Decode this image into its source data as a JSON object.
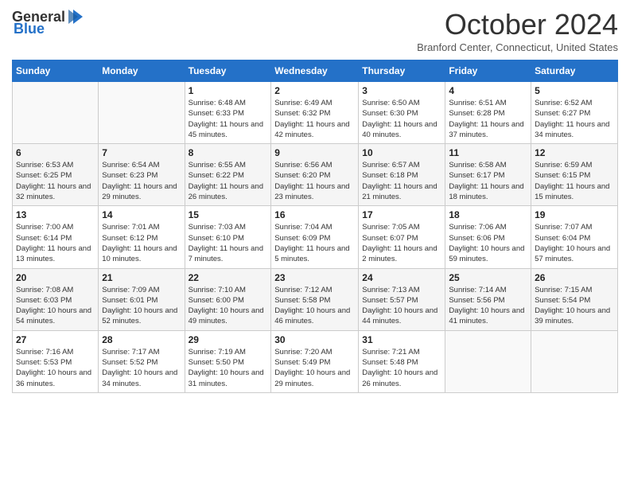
{
  "header": {
    "logo_general": "General",
    "logo_blue": "Blue",
    "title": "October 2024",
    "location": "Branford Center, Connecticut, United States"
  },
  "days_of_week": [
    "Sunday",
    "Monday",
    "Tuesday",
    "Wednesday",
    "Thursday",
    "Friday",
    "Saturday"
  ],
  "weeks": [
    [
      {
        "day": "",
        "info": ""
      },
      {
        "day": "",
        "info": ""
      },
      {
        "day": "1",
        "info": "Sunrise: 6:48 AM\nSunset: 6:33 PM\nDaylight: 11 hours and 45 minutes."
      },
      {
        "day": "2",
        "info": "Sunrise: 6:49 AM\nSunset: 6:32 PM\nDaylight: 11 hours and 42 minutes."
      },
      {
        "day": "3",
        "info": "Sunrise: 6:50 AM\nSunset: 6:30 PM\nDaylight: 11 hours and 40 minutes."
      },
      {
        "day": "4",
        "info": "Sunrise: 6:51 AM\nSunset: 6:28 PM\nDaylight: 11 hours and 37 minutes."
      },
      {
        "day": "5",
        "info": "Sunrise: 6:52 AM\nSunset: 6:27 PM\nDaylight: 11 hours and 34 minutes."
      }
    ],
    [
      {
        "day": "6",
        "info": "Sunrise: 6:53 AM\nSunset: 6:25 PM\nDaylight: 11 hours and 32 minutes."
      },
      {
        "day": "7",
        "info": "Sunrise: 6:54 AM\nSunset: 6:23 PM\nDaylight: 11 hours and 29 minutes."
      },
      {
        "day": "8",
        "info": "Sunrise: 6:55 AM\nSunset: 6:22 PM\nDaylight: 11 hours and 26 minutes."
      },
      {
        "day": "9",
        "info": "Sunrise: 6:56 AM\nSunset: 6:20 PM\nDaylight: 11 hours and 23 minutes."
      },
      {
        "day": "10",
        "info": "Sunrise: 6:57 AM\nSunset: 6:18 PM\nDaylight: 11 hours and 21 minutes."
      },
      {
        "day": "11",
        "info": "Sunrise: 6:58 AM\nSunset: 6:17 PM\nDaylight: 11 hours and 18 minutes."
      },
      {
        "day": "12",
        "info": "Sunrise: 6:59 AM\nSunset: 6:15 PM\nDaylight: 11 hours and 15 minutes."
      }
    ],
    [
      {
        "day": "13",
        "info": "Sunrise: 7:00 AM\nSunset: 6:14 PM\nDaylight: 11 hours and 13 minutes."
      },
      {
        "day": "14",
        "info": "Sunrise: 7:01 AM\nSunset: 6:12 PM\nDaylight: 11 hours and 10 minutes."
      },
      {
        "day": "15",
        "info": "Sunrise: 7:03 AM\nSunset: 6:10 PM\nDaylight: 11 hours and 7 minutes."
      },
      {
        "day": "16",
        "info": "Sunrise: 7:04 AM\nSunset: 6:09 PM\nDaylight: 11 hours and 5 minutes."
      },
      {
        "day": "17",
        "info": "Sunrise: 7:05 AM\nSunset: 6:07 PM\nDaylight: 11 hours and 2 minutes."
      },
      {
        "day": "18",
        "info": "Sunrise: 7:06 AM\nSunset: 6:06 PM\nDaylight: 10 hours and 59 minutes."
      },
      {
        "day": "19",
        "info": "Sunrise: 7:07 AM\nSunset: 6:04 PM\nDaylight: 10 hours and 57 minutes."
      }
    ],
    [
      {
        "day": "20",
        "info": "Sunrise: 7:08 AM\nSunset: 6:03 PM\nDaylight: 10 hours and 54 minutes."
      },
      {
        "day": "21",
        "info": "Sunrise: 7:09 AM\nSunset: 6:01 PM\nDaylight: 10 hours and 52 minutes."
      },
      {
        "day": "22",
        "info": "Sunrise: 7:10 AM\nSunset: 6:00 PM\nDaylight: 10 hours and 49 minutes."
      },
      {
        "day": "23",
        "info": "Sunrise: 7:12 AM\nSunset: 5:58 PM\nDaylight: 10 hours and 46 minutes."
      },
      {
        "day": "24",
        "info": "Sunrise: 7:13 AM\nSunset: 5:57 PM\nDaylight: 10 hours and 44 minutes."
      },
      {
        "day": "25",
        "info": "Sunrise: 7:14 AM\nSunset: 5:56 PM\nDaylight: 10 hours and 41 minutes."
      },
      {
        "day": "26",
        "info": "Sunrise: 7:15 AM\nSunset: 5:54 PM\nDaylight: 10 hours and 39 minutes."
      }
    ],
    [
      {
        "day": "27",
        "info": "Sunrise: 7:16 AM\nSunset: 5:53 PM\nDaylight: 10 hours and 36 minutes."
      },
      {
        "day": "28",
        "info": "Sunrise: 7:17 AM\nSunset: 5:52 PM\nDaylight: 10 hours and 34 minutes."
      },
      {
        "day": "29",
        "info": "Sunrise: 7:19 AM\nSunset: 5:50 PM\nDaylight: 10 hours and 31 minutes."
      },
      {
        "day": "30",
        "info": "Sunrise: 7:20 AM\nSunset: 5:49 PM\nDaylight: 10 hours and 29 minutes."
      },
      {
        "day": "31",
        "info": "Sunrise: 7:21 AM\nSunset: 5:48 PM\nDaylight: 10 hours and 26 minutes."
      },
      {
        "day": "",
        "info": ""
      },
      {
        "day": "",
        "info": ""
      }
    ]
  ]
}
